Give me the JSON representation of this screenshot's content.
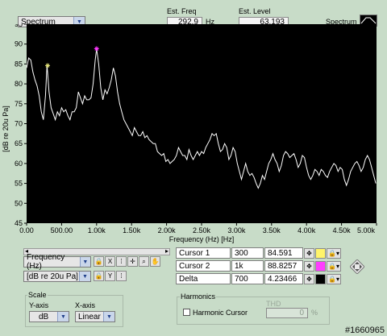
{
  "topbar": {
    "mode_select": "Spectrum",
    "est_freq_label": "Est. Freq",
    "est_freq_value": "292.9",
    "est_freq_unit": "Hz",
    "est_level_label": "Est. Level",
    "est_level_value": "63.193",
    "legend_label": "Spectrum"
  },
  "chart_data": {
    "type": "line",
    "xlabel": "Frequency (Hz) [Hz]",
    "ylabel": "[dB re 20u Pa]",
    "xlim": [
      0,
      5000
    ],
    "ylim": [
      45,
      95
    ],
    "x_ticks": [
      "0.00",
      "500.00",
      "1.00k",
      "1.50k",
      "2.00k",
      "2.50k",
      "3.00k",
      "3.50k",
      "4.00k",
      "4.50k",
      "5.00k"
    ],
    "y_ticks": [
      "95",
      "90",
      "85",
      "80",
      "75",
      "70",
      "65",
      "60",
      "55",
      "50",
      "45"
    ],
    "grid": false,
    "background": "#000000",
    "line_color": "#ffffff",
    "x": [
      0,
      30,
      60,
      90,
      120,
      150,
      180,
      210,
      240,
      270,
      292,
      300,
      320,
      350,
      380,
      410,
      440,
      470,
      500,
      530,
      560,
      590,
      620,
      650,
      680,
      710,
      740,
      770,
      800,
      830,
      860,
      890,
      920,
      950,
      980,
      1000,
      1030,
      1060,
      1090,
      1120,
      1150,
      1180,
      1210,
      1240,
      1270,
      1300,
      1330,
      1360,
      1390,
      1420,
      1450,
      1480,
      1510,
      1540,
      1570,
      1600,
      1630,
      1660,
      1690,
      1720,
      1750,
      1780,
      1810,
      1840,
      1870,
      1900,
      1930,
      1960,
      1990,
      2020,
      2050,
      2080,
      2110,
      2140,
      2170,
      2200,
      2230,
      2260,
      2290,
      2320,
      2350,
      2380,
      2410,
      2440,
      2470,
      2500,
      2530,
      2560,
      2590,
      2620,
      2650,
      2680,
      2710,
      2740,
      2770,
      2800,
      2830,
      2860,
      2890,
      2920,
      2950,
      2980,
      3010,
      3040,
      3070,
      3100,
      3130,
      3160,
      3190,
      3220,
      3250,
      3280,
      3310,
      3340,
      3370,
      3400,
      3430,
      3460,
      3490,
      3520,
      3550,
      3580,
      3610,
      3640,
      3670,
      3700,
      3730,
      3760,
      3790,
      3820,
      3850,
      3880,
      3910,
      3940,
      3970,
      4000,
      4030,
      4060,
      4090,
      4120,
      4150,
      4180,
      4210,
      4240,
      4270,
      4300,
      4330,
      4360,
      4390,
      4420,
      4450,
      4480,
      4510,
      4540,
      4570,
      4600,
      4630,
      4660,
      4690,
      4720,
      4750,
      4780,
      4810,
      4840,
      4870,
      4900,
      4930,
      4960,
      4990
    ],
    "y": [
      84,
      86.5,
      86,
      83,
      81,
      79.5,
      77,
      73,
      71,
      77,
      84.6,
      83,
      78,
      74,
      72.5,
      71,
      73,
      72,
      74,
      73,
      73.5,
      72,
      71,
      73,
      73,
      74,
      78,
      76.5,
      75,
      77,
      76,
      76,
      76.5,
      80,
      86,
      88.8,
      85,
      79,
      76,
      78.5,
      77.5,
      79,
      81,
      84,
      82,
      78,
      75,
      73,
      71,
      70,
      69,
      68,
      67,
      69,
      68,
      67,
      67,
      68,
      66.5,
      67,
      66,
      65.5,
      65,
      65,
      63,
      62.5,
      62,
      62.5,
      60.5,
      61,
      60,
      60.5,
      61,
      62,
      64,
      63,
      62,
      62,
      61,
      63.5,
      62,
      61,
      62,
      63,
      62,
      63,
      62.5,
      64,
      65,
      66,
      67.5,
      67,
      67.5,
      65,
      63,
      63.5,
      65,
      64,
      61,
      62,
      64,
      63,
      60,
      58,
      56,
      58,
      60,
      58,
      57,
      57.5,
      56.5,
      55,
      53.8,
      55,
      57,
      56,
      58,
      60,
      61,
      62.5,
      61,
      60,
      58,
      59.5,
      62,
      63,
      62.5,
      61.5,
      62,
      62.5,
      61,
      59,
      60,
      62,
      61.5,
      59,
      57,
      56,
      57,
      58.5,
      58,
      57,
      58.5,
      58,
      57,
      56.5,
      58,
      59,
      60,
      59.5,
      58,
      59,
      58.5,
      56,
      54.5,
      56,
      58,
      59,
      60,
      60.5,
      59.5,
      58,
      59,
      61,
      62,
      61,
      59,
      57,
      55,
      54,
      55,
      54.5
    ]
  },
  "markers": {
    "cursor1": {
      "x": 300,
      "y": 84.591,
      "color": "#e6e67a"
    },
    "cursor2": {
      "x": 1000,
      "y": 88.8257,
      "color": "#ff38ff"
    }
  },
  "lower_left": {
    "x_unit_select": "Frequency (Hz)",
    "y_unit_select": "[dB re 20u Pa]"
  },
  "scale": {
    "title": "Scale",
    "y_axis_label": "Y-axis",
    "x_axis_label": "X-axis",
    "y_axis_value": "dB",
    "x_axis_value": "Linear"
  },
  "cursors": {
    "rows": [
      {
        "name": "Cursor 1",
        "x": "300",
        "y": "84.591",
        "swatch": "#fff46a"
      },
      {
        "name": "Cursor 2",
        "x": "1k",
        "y": "88.8257",
        "swatch": "#ff3cff"
      },
      {
        "name": "Delta",
        "x": "700",
        "y": "4.23466",
        "swatch": "#000000"
      }
    ]
  },
  "harmonics": {
    "title": "Harmonics",
    "harmonic_cursor_label": "Harmonic Cursor",
    "thd_label": "THD",
    "thd_value": "0",
    "thd_unit": "%"
  },
  "watermark": "#1660965"
}
